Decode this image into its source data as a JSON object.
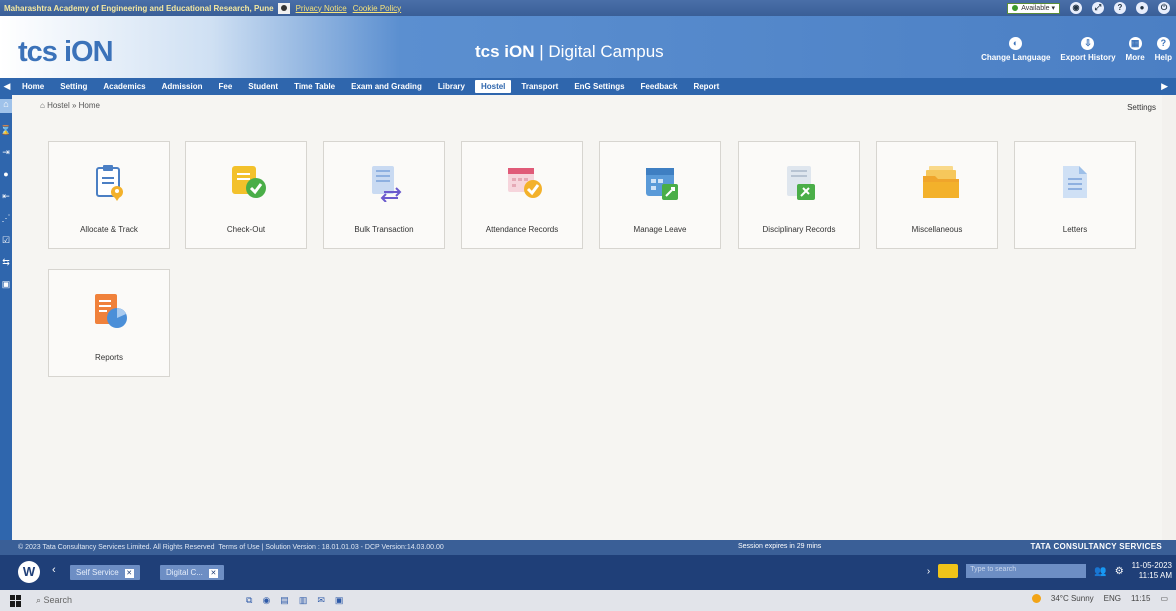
{
  "topbar": {
    "institution": "Maharashtra Academy of Engineering and Educational Research, Pune",
    "privacy_notice": "Privacy Notice",
    "cookie_policy": "Cookie Policy",
    "status": "Available"
  },
  "header": {
    "logo": "tcs iON",
    "brand_prefix": "tcs iON",
    "brand_suffix": "| Digital Campus",
    "actions": [
      {
        "label": "Change Language",
        "icon": "globe-icon"
      },
      {
        "label": "Export History",
        "icon": "export-icon"
      },
      {
        "label": "More",
        "icon": "grid-icon"
      },
      {
        "label": "Help",
        "icon": "help-icon"
      }
    ]
  },
  "nav": {
    "items": [
      "Home",
      "Setting",
      "Academics",
      "Admission",
      "Fee",
      "Student",
      "Time Table",
      "Exam and Grading",
      "Library",
      "Hostel",
      "Transport",
      "EnG Settings",
      "Feedback",
      "Report"
    ],
    "active": "Hostel"
  },
  "breadcrumb": "Hostel » Home",
  "settings_link": "Settings",
  "tiles": [
    {
      "label": "Allocate & Track",
      "icon": "allocate-track-icon"
    },
    {
      "label": "Check-Out",
      "icon": "check-out-icon"
    },
    {
      "label": "Bulk Transaction",
      "icon": "bulk-transaction-icon"
    },
    {
      "label": "Attendance Records",
      "icon": "attendance-records-icon"
    },
    {
      "label": "Manage Leave",
      "icon": "manage-leave-icon"
    },
    {
      "label": "Disciplinary Records",
      "icon": "disciplinary-records-icon"
    },
    {
      "label": "Miscellaneous",
      "icon": "miscellaneous-icon"
    },
    {
      "label": "Letters",
      "icon": "letters-icon"
    },
    {
      "label": "Reports",
      "icon": "reports-icon"
    }
  ],
  "footer": {
    "copyright": "© 2023 Tata Consultancy Services Limited. All Rights Reserved",
    "terms": "Terms of Use",
    "version": "Solution Version : 18.01.01.03 - DCP Version:14.03.00.00",
    "session": "Session expires in 29 mins",
    "company": "TATA CONSULTANCY SERVICES"
  },
  "citrix": {
    "tabs": [
      "Self Service",
      "Digital C..."
    ],
    "search_placeholder": "Type to search",
    "date": "11-05-2023",
    "time": "11:15 AM"
  },
  "taskbar": {
    "search": "Search",
    "weather": "34°C  Sunny",
    "lang": "ENG",
    "clock": "11:15"
  },
  "colors": {
    "header_blue": "#4b7fc4",
    "nav_blue": "#2f66ad",
    "footer_blue": "#3a5f97"
  }
}
